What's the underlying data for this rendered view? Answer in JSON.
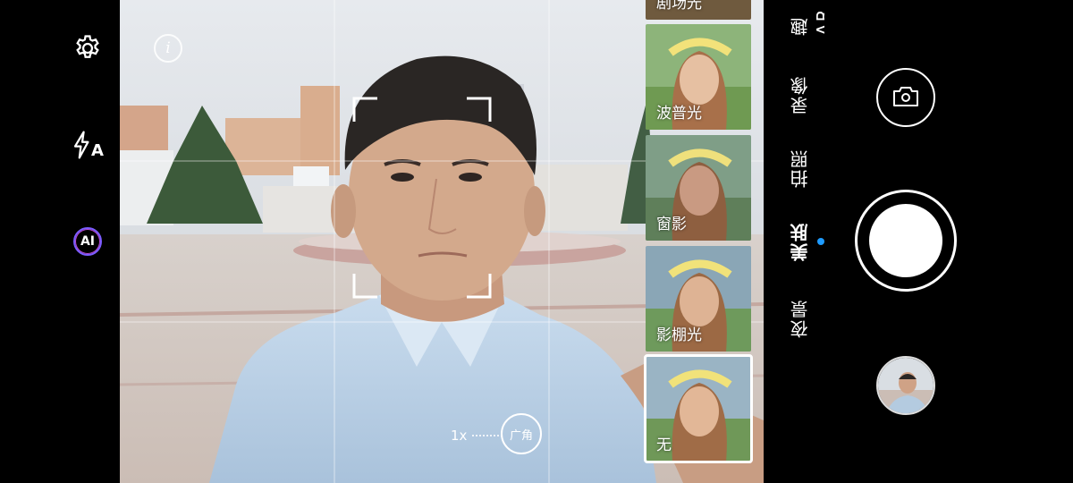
{
  "top_left_tool": {
    "icon": "settings-gear-icon"
  },
  "flash": {
    "icon": "flash-auto-icon",
    "label": "A"
  },
  "ai_button": {
    "label": "AI"
  },
  "info": {
    "icon": "info-icon",
    "label": "i"
  },
  "zoom": {
    "current": "1x",
    "wide_label": "广角"
  },
  "filters": [
    {
      "label": "剧场光"
    },
    {
      "label": "波普光"
    },
    {
      "label": "窗影"
    },
    {
      "label": "影棚光"
    },
    {
      "label": "无",
      "selected": true
    }
  ],
  "modes": [
    {
      "label": "趣AR"
    },
    {
      "label": "录像"
    },
    {
      "label": "拍照"
    },
    {
      "label": "美肤",
      "active": true
    },
    {
      "label": "夜景"
    }
  ],
  "controls": {
    "switch_camera_icon": "switch-camera-icon",
    "shutter_icon": "shutter-button",
    "gallery_icon": "gallery-thumbnail"
  },
  "colors": {
    "accent": "#1e9bff",
    "background": "#000000"
  }
}
